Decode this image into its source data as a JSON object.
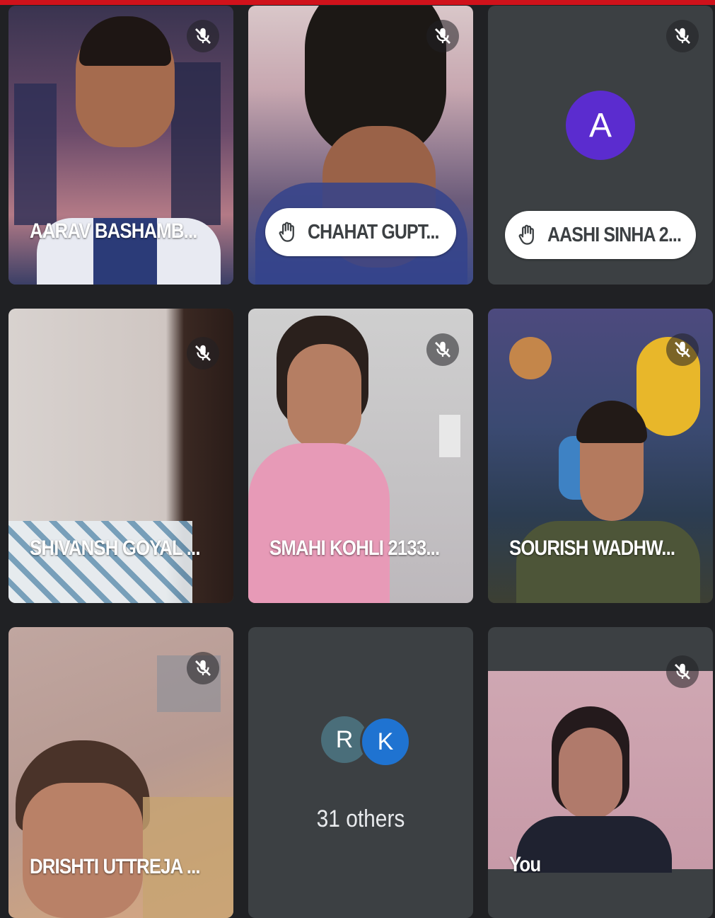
{
  "colors": {
    "accent_bar": "#d0121b",
    "background": "#202124",
    "tile": "#3c4043",
    "avatar_a": "#5b2ccf",
    "avatar_r": "#4a6e7a",
    "avatar_k": "#1f73d1"
  },
  "tiles": [
    {
      "name": "AARAV BASHAMB...",
      "muted": true
    },
    {
      "name": "CHAHAT GUPT...",
      "muted": true,
      "hand_raised": true
    },
    {
      "name": "AASHI SINHA 2...",
      "muted": true,
      "hand_raised": true,
      "avatar_letter": "A"
    },
    {
      "name": "SHIVANSH GOYAL ...",
      "muted": true
    },
    {
      "name": "SMAHI KOHLI 2133...",
      "muted": true
    },
    {
      "name": "SOURISH WADHW...",
      "muted": true
    },
    {
      "name": "DRISHTI UTTREJA ...",
      "muted": true
    },
    {
      "others_label": "31 others",
      "avatar_letters": [
        "R",
        "K"
      ]
    },
    {
      "name": "You",
      "muted": true
    }
  ],
  "icons": {
    "mic_off": "mic-off-icon",
    "hand": "raised-hand-icon"
  }
}
